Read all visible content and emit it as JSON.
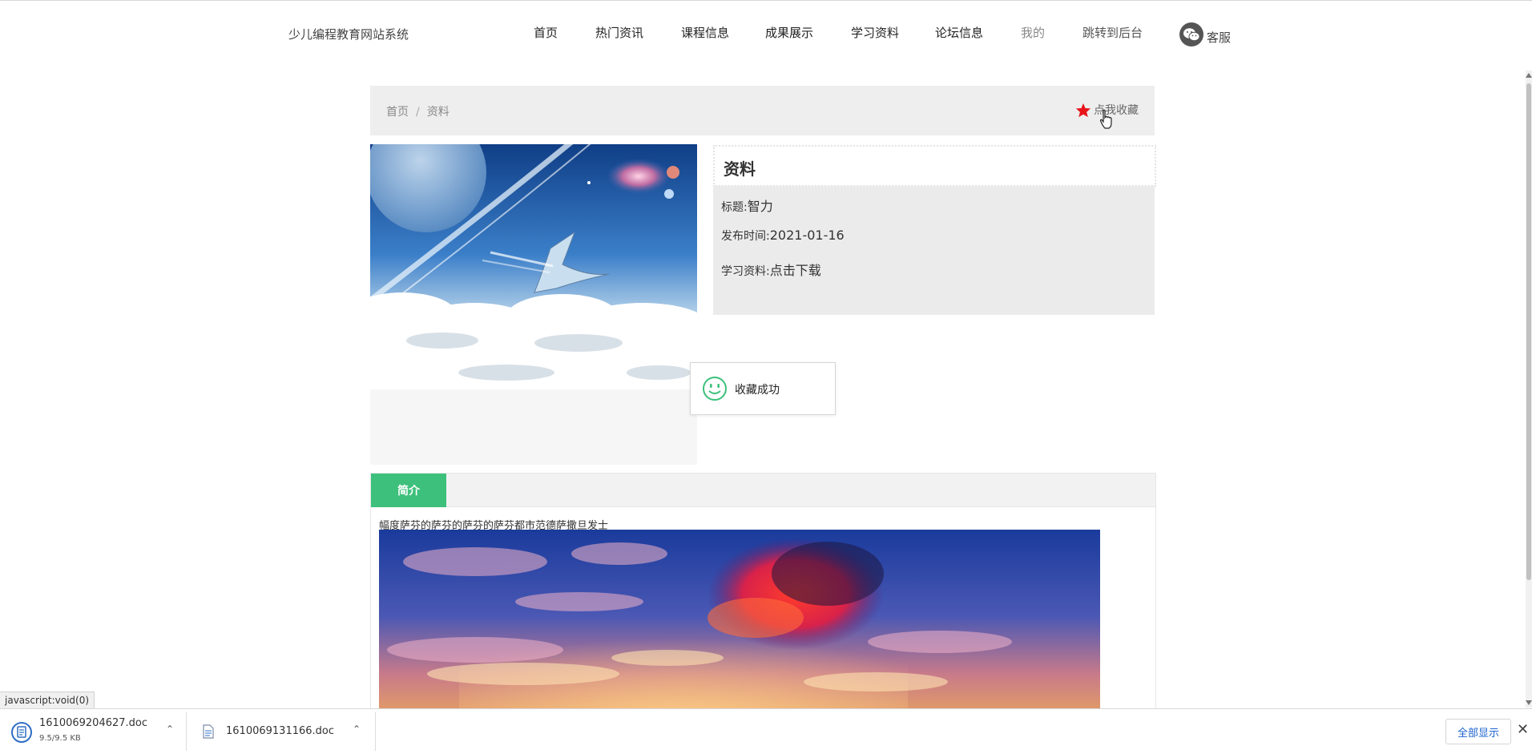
{
  "header": {
    "site_title": "少儿编程教育网站系统",
    "nav": [
      "首页",
      "热门资讯",
      "课程信息",
      "成果展示",
      "学习资料",
      "论坛信息",
      "我的",
      "跳转到后台"
    ],
    "service_label": "客服"
  },
  "breadcrumb": {
    "home": "首页",
    "separator": "/",
    "current": "资料"
  },
  "favorite_label": "点我收藏",
  "info": {
    "heading": "资料",
    "title_label": "标题:",
    "title_value": "智力",
    "date_label": "发布时间:",
    "date_value": "2021-01-16",
    "file_label": "学习资料:",
    "file_link": "点击下载"
  },
  "toast": {
    "message": "收藏成功"
  },
  "intro": {
    "tab_label": "简介",
    "description": "幅度萨芬的萨芬的萨芬的萨芬都市范德萨撒旦发士"
  },
  "status_url": "javascript:void(0)",
  "downloads": {
    "items": [
      {
        "filename": "1610069204627.doc",
        "size": "9.5/9.5 KB"
      },
      {
        "filename": "1610069131166.doc",
        "size": ""
      }
    ],
    "show_all_label": "全部显示"
  },
  "colors": {
    "accent_green": "#3cc07b",
    "star_red": "#e8141a",
    "link_blue": "#1a62d0"
  },
  "icons": {
    "service": "wechat-icon",
    "favorite": "star-icon",
    "toast": "smile-icon",
    "download_file": "doc-file-icon"
  }
}
